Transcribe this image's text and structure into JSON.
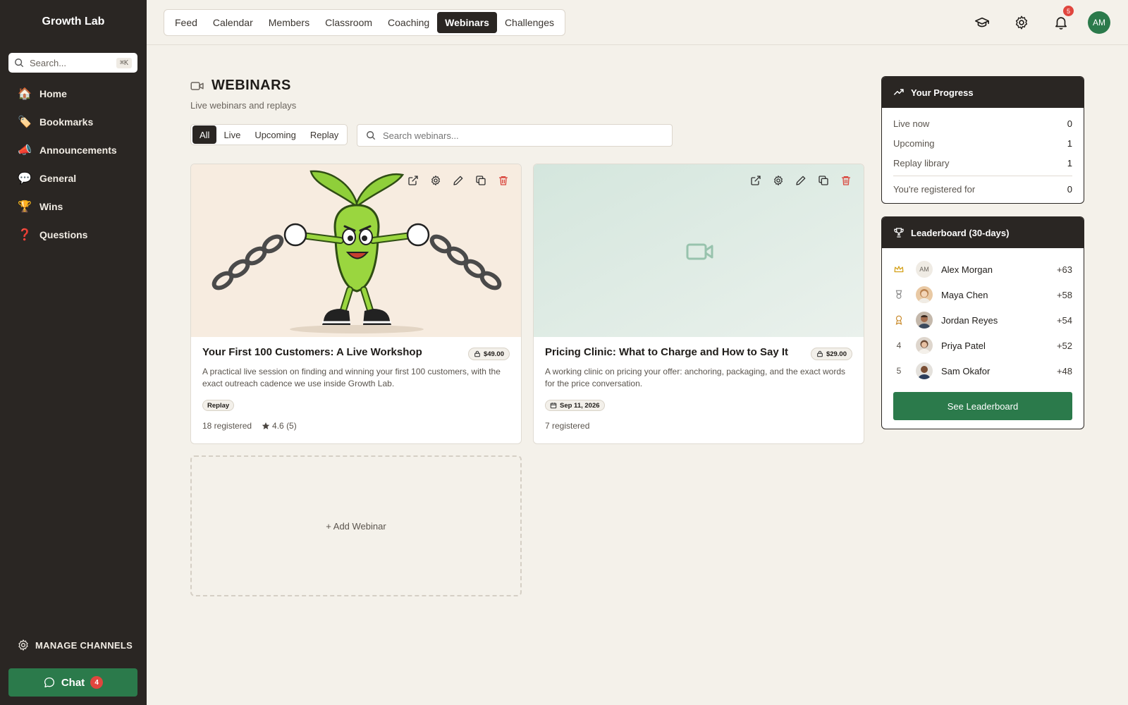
{
  "sidebar": {
    "brand": "Growth Lab",
    "search_placeholder": "Search...",
    "search_shortcut": "⌘K",
    "items": [
      {
        "label": "Home",
        "emoji": "🏠"
      },
      {
        "label": "Bookmarks",
        "emoji": "🏷️"
      },
      {
        "label": "Announcements",
        "emoji": "📣"
      },
      {
        "label": "General",
        "emoji": "💬"
      },
      {
        "label": "Wins",
        "emoji": "🏆"
      },
      {
        "label": "Questions",
        "emoji": "❓"
      }
    ],
    "manage_label": "MANAGE CHANNELS",
    "chat_label": "Chat",
    "chat_count": "4"
  },
  "topnav": {
    "tabs": [
      "Feed",
      "Calendar",
      "Members",
      "Classroom",
      "Coaching",
      "Webinars",
      "Challenges"
    ],
    "active_tab": "Webinars",
    "icons": [
      "graduation-cap-icon",
      "gear-icon",
      "bell-icon"
    ],
    "notification_count": "5",
    "avatar_initials": "AM"
  },
  "main": {
    "title": "WEBINARS",
    "subtitle": "Live webinars and replays",
    "filters": [
      "All",
      "Live",
      "Upcoming",
      "Replay"
    ],
    "active_filter": "All",
    "search_placeholder": "Search webinars...",
    "add_label": "+ Add Webinar",
    "cards": [
      {
        "title": "Your First 100 Customers: A Live Workshop",
        "price": "$49.00",
        "description": "A practical live session on finding and winning your first 100 customers, with the exact outreach cadence we use inside Growth Lab.",
        "chip": "Replay",
        "registered": "18 registered",
        "rating": "4.6 (5)"
      },
      {
        "title": "Pricing Clinic: What to Charge and How to Say It",
        "price": "$29.00",
        "description": "A working clinic on pricing your offer: anchoring, packaging, and the exact words for the price conversation.",
        "chip": "Sep 11, 2026",
        "registered": "7 registered"
      }
    ]
  },
  "progress": {
    "title": "Your Progress",
    "rows": [
      {
        "label": "Live now",
        "value": "0"
      },
      {
        "label": "Upcoming",
        "value": "1"
      },
      {
        "label": "Replay library",
        "value": "1"
      }
    ],
    "registered_label": "You're registered for",
    "registered_value": "0"
  },
  "leaderboard": {
    "title": "Leaderboard (30-days)",
    "entries": [
      {
        "rank_icon": "crown-icon",
        "initials": "AM",
        "name": "Alex Morgan",
        "points": "+63"
      },
      {
        "rank_icon": "silver-medal-icon",
        "name": "Maya Chen",
        "points": "+58"
      },
      {
        "rank_icon": "bronze-medal-icon",
        "name": "Jordan Reyes",
        "points": "+54"
      },
      {
        "rank": "4",
        "name": "Priya Patel",
        "points": "+52"
      },
      {
        "rank": "5",
        "name": "Sam Okafor",
        "points": "+48"
      }
    ],
    "button_label": "See Leaderboard"
  },
  "colors": {
    "sidebar_bg": "#2a2623",
    "accent_green": "#2b7a4b",
    "badge_red": "#e0463e",
    "page_bg": "#f4f1ea"
  }
}
